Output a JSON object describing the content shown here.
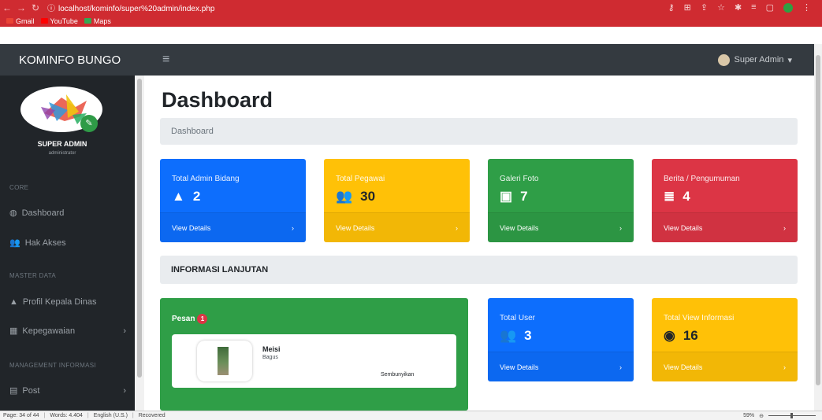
{
  "browser": {
    "url": "localhost/kominfo/super%20admin/index.php",
    "bookmarks": [
      {
        "label": "Gmail",
        "color": "#ea4335"
      },
      {
        "label": "YouTube",
        "color": "#ff0000"
      },
      {
        "label": "Maps",
        "color": "#34a853"
      }
    ]
  },
  "topnav": {
    "brand": "KOMINFO BUNGO",
    "user": "Super Admin"
  },
  "sidebar": {
    "user_name": "SUPER ADMIN",
    "user_sub": "administrator",
    "headings": [
      "CORE",
      "MASTER DATA",
      "MANAGEMENT INFORMASI"
    ],
    "items": [
      {
        "label": "Dashboard",
        "icon": "dashboard-icon"
      },
      {
        "label": "Hak Akses",
        "icon": "users-icon"
      },
      {
        "label": "Profil Kepala Dinas",
        "icon": "user-icon"
      },
      {
        "label": "Kepegawaian",
        "icon": "table-icon"
      },
      {
        "label": "Post",
        "icon": "post-icon"
      }
    ]
  },
  "main": {
    "title": "Dashboard",
    "breadcrumb": "Dashboard",
    "stat_cards": [
      {
        "label": "Total Admin Bidang",
        "value": "2",
        "footer": "View Details",
        "color": "#0d6efd"
      },
      {
        "label": "Total Pegawai",
        "value": "30",
        "footer": "View Details",
        "color": "#ffc107"
      },
      {
        "label": "Galeri Foto",
        "value": "7",
        "footer": "View Details",
        "color": "#2f9e47"
      },
      {
        "label": "Berita / Pengumuman",
        "value": "4",
        "footer": "View Details",
        "color": "#dc3545"
      }
    ],
    "section_title": "INFORMASI LANJUTAN",
    "pesan": {
      "title": "Pesan",
      "badge": "1",
      "message_name": "Meisi",
      "message_text": "Bagus",
      "hide_label": "Sembunyikan"
    },
    "info_cards": [
      {
        "label": "Total User",
        "value": "3",
        "footer": "View Details",
        "color": "#0d6efd"
      },
      {
        "label": "Total View Informasi",
        "value": "16",
        "footer": "View Details",
        "color": "#ffc107"
      }
    ]
  },
  "statusbar": {
    "page": "Page: 34 of 44",
    "words": "Words: 4.404",
    "language": "English (U.S.)",
    "recovered": "Recovered",
    "zoom": "59%"
  }
}
